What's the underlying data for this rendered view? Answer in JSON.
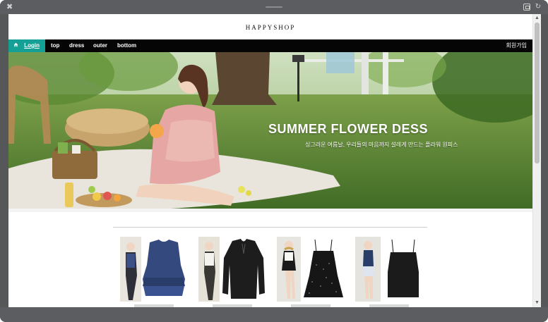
{
  "shop": {
    "name": "HAPPYSHOP"
  },
  "nav": {
    "login": "Login",
    "items": [
      "top",
      "dress",
      "outer",
      "bottom"
    ],
    "signup": "회원가입"
  },
  "hero": {
    "title": "SUMMER FLOWER DESS",
    "subtitle": "싱그러운 여름날, 우리들의 마음까지 설레게 만드는 플라워 원피스"
  },
  "products": [
    {
      "name": "navy-ruffle-top",
      "color": "#2e4374"
    },
    {
      "name": "black-blouse",
      "color": "#1c1c1c"
    },
    {
      "name": "black-dot-dress",
      "color": "#191919"
    },
    {
      "name": "black-cami-top",
      "color": "#1b1b1b"
    }
  ],
  "colors": {
    "accent": "#15a095",
    "nav_bg": "#050505"
  }
}
